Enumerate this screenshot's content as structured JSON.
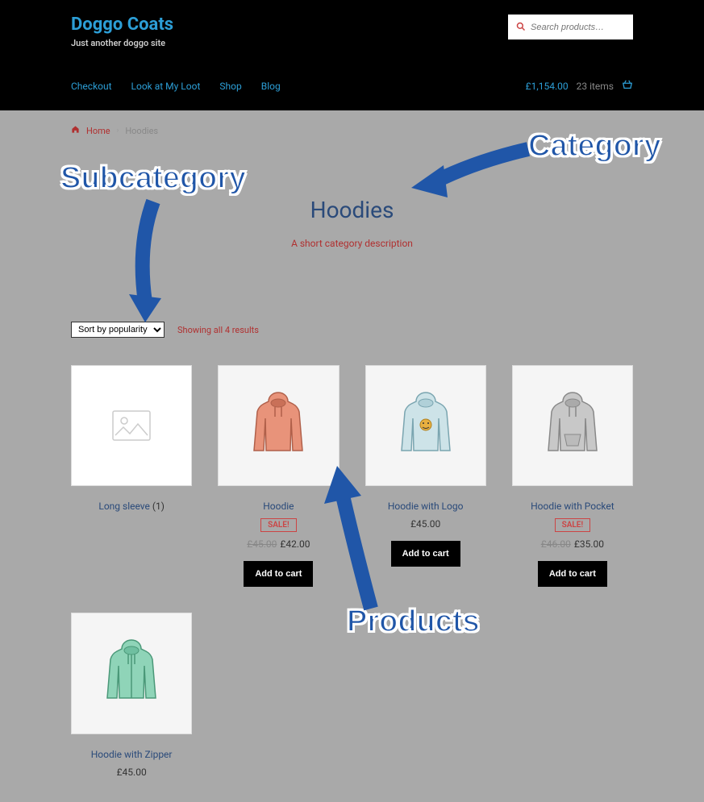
{
  "site": {
    "title": "Doggo Coats",
    "tagline": "Just another doggo site"
  },
  "search": {
    "placeholder": "Search products…"
  },
  "nav": {
    "items": [
      "Checkout",
      "Look at My Loot",
      "Shop",
      "Blog"
    ]
  },
  "cart": {
    "total": "£1,154.00",
    "count": "23 items"
  },
  "breadcrumb": {
    "home": "Home",
    "current": "Hoodies"
  },
  "page": {
    "title": "Hoodies",
    "description": "A short category description"
  },
  "toolbar": {
    "sort": "Sort by popularity",
    "results": "Showing all 4 results"
  },
  "buttons": {
    "add_to_cart": "Add to cart",
    "sale": "SALE!"
  },
  "products": [
    {
      "name": "Long sleeve",
      "count": "(1)"
    },
    {
      "name": "Hoodie",
      "sale": true,
      "old_price": "£45.00",
      "price": "£42.00",
      "add": true
    },
    {
      "name": "Hoodie with Logo",
      "price": "£45.00",
      "add": true
    },
    {
      "name": "Hoodie with Pocket",
      "sale": true,
      "old_price": "£46.00",
      "price": "£35.00",
      "add": true
    },
    {
      "name": "Hoodie with Zipper",
      "price": "£45.00"
    }
  ],
  "annotations": {
    "subcategory": "Subcategory",
    "category": "Category",
    "products": "Products"
  }
}
